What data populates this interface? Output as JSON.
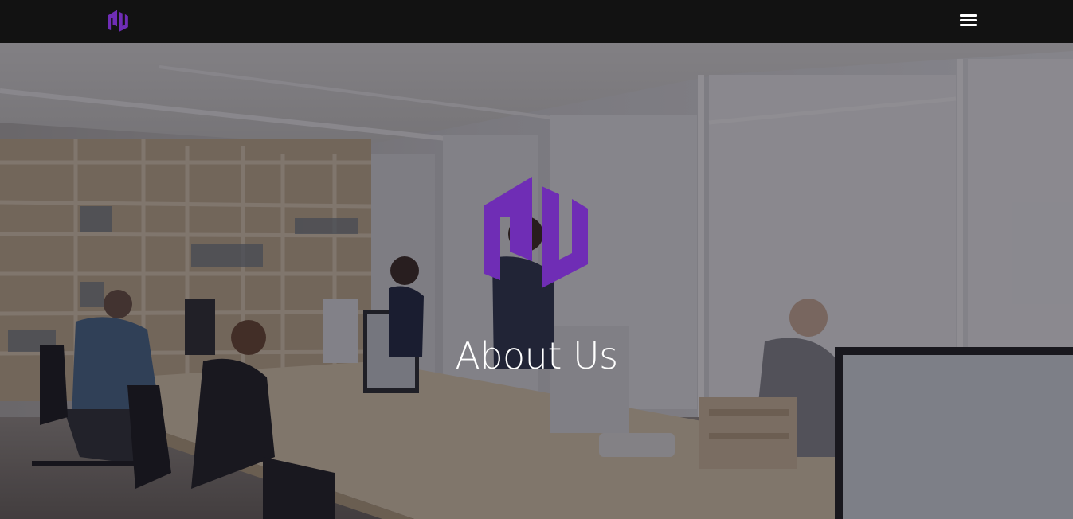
{
  "header": {
    "logo_icon": "brand-monogram-icon",
    "menu_icon": "hamburger-menu-icon"
  },
  "hero": {
    "title": "About Us",
    "background_image": "office-coworkers-photo",
    "logo_icon": "brand-monogram-icon"
  },
  "colors": {
    "brand_purple": "#6f2db5",
    "topbar": "#121212",
    "title_text": "#ffffff"
  }
}
